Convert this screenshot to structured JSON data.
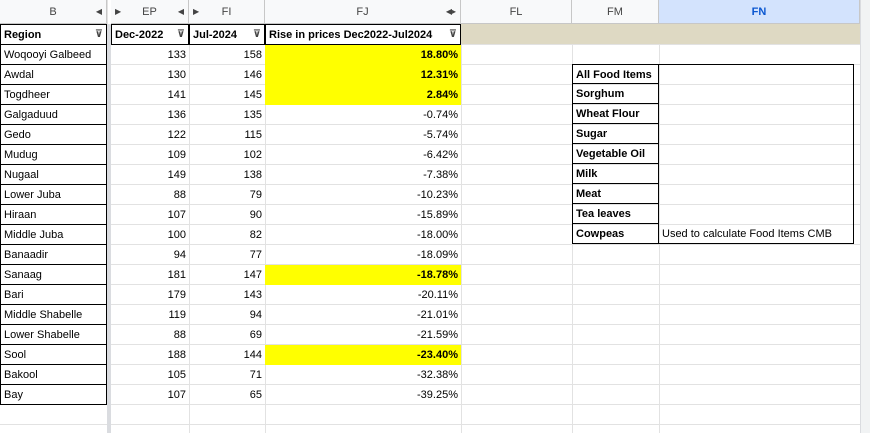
{
  "columns": [
    {
      "label": "B"
    },
    {
      "label": "EP"
    },
    {
      "label": "FI"
    },
    {
      "label": "FJ"
    },
    {
      "label": "FL"
    },
    {
      "label": "FM"
    },
    {
      "label": "FN"
    }
  ],
  "table": {
    "headers": [
      "Region",
      "Dec-2022",
      "Jul-2024",
      "Rise in prices Dec2022-Jul2024"
    ],
    "rows": [
      {
        "region": "Woqooyi Galbeed",
        "dec": "133",
        "jul": "158",
        "rise": "18.80%",
        "hl": true
      },
      {
        "region": "Awdal",
        "dec": "130",
        "jul": "146",
        "rise": "12.31%",
        "hl": true
      },
      {
        "region": "Togdheer",
        "dec": "141",
        "jul": "145",
        "rise": "2.84%",
        "hl": true
      },
      {
        "region": "Galgaduud",
        "dec": "136",
        "jul": "135",
        "rise": "-0.74%",
        "hl": false
      },
      {
        "region": "Gedo",
        "dec": "122",
        "jul": "115",
        "rise": "-5.74%",
        "hl": false
      },
      {
        "region": "Mudug",
        "dec": "109",
        "jul": "102",
        "rise": "-6.42%",
        "hl": false
      },
      {
        "region": "Nugaal",
        "dec": "149",
        "jul": "138",
        "rise": "-7.38%",
        "hl": false
      },
      {
        "region": "Lower Juba",
        "dec": "88",
        "jul": "79",
        "rise": "-10.23%",
        "hl": false
      },
      {
        "region": "Hiraan",
        "dec": "107",
        "jul": "90",
        "rise": "-15.89%",
        "hl": false
      },
      {
        "region": "Middle Juba",
        "dec": "100",
        "jul": "82",
        "rise": "-18.00%",
        "hl": false
      },
      {
        "region": "Banaadir",
        "dec": "94",
        "jul": "77",
        "rise": "-18.09%",
        "hl": false
      },
      {
        "region": "Sanaag",
        "dec": "181",
        "jul": "147",
        "rise": "-18.78%",
        "hl": true
      },
      {
        "region": "Bari",
        "dec": "179",
        "jul": "143",
        "rise": "-20.11%",
        "hl": false
      },
      {
        "region": "Middle Shabelle",
        "dec": "119",
        "jul": "94",
        "rise": "-21.01%",
        "hl": false
      },
      {
        "region": "Lower Shabelle",
        "dec": "88",
        "jul": "69",
        "rise": "-21.59%",
        "hl": false
      },
      {
        "region": "Sool",
        "dec": "188",
        "jul": "144",
        "rise": "-23.40%",
        "hl": true
      },
      {
        "region": "Bakool",
        "dec": "105",
        "jul": "71",
        "rise": "-32.38%",
        "hl": false
      },
      {
        "region": "Bay",
        "dec": "107",
        "jul": "65",
        "rise": "-39.25%",
        "hl": false
      }
    ]
  },
  "side_table": {
    "items": [
      "All Food Items",
      "Sorghum",
      "Wheat Flour",
      "Sugar",
      "Vegetable Oil",
      "Milk",
      "Meat",
      "Tea leaves",
      "Cowpeas"
    ],
    "note": "Used to calculate Food Items CMB"
  },
  "colors": {
    "highlight": "#ffff00",
    "header_band": "#ded9c3",
    "selected_col": "#d3e3fd"
  },
  "icons": {
    "filter": "filter-icon",
    "arrow": "column-nav-arrow"
  }
}
